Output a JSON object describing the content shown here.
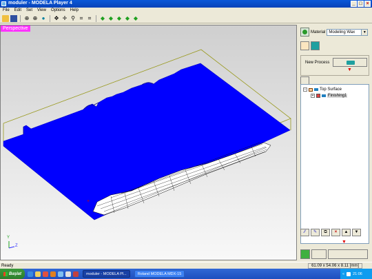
{
  "window": {
    "title": "moduler - MODELA Player 4",
    "controls": [
      "_",
      "□",
      "×"
    ]
  },
  "menu": [
    "File",
    "Edit",
    "Set",
    "View",
    "Options",
    "Help"
  ],
  "viewport": {
    "label": "Perspective",
    "axis_y": "Y",
    "axis_z": "Z"
  },
  "panel": {
    "material_label": "Material",
    "material_value": "Modeling Wax",
    "new_process_label": "New Process",
    "tree": {
      "root": "Top Surface",
      "child": "Finishing1",
      "root_expander": "−",
      "child_expander": "+"
    },
    "buttons": {
      "delete": "×",
      "up": "▲",
      "down": "▼"
    }
  },
  "status": {
    "text": "Ready",
    "dimensions": "61.09 x 54.06 x 8.11 [mm]"
  },
  "taskbar": {
    "start": "Başlat",
    "tasks": [
      "moduler - MODELA Pl...",
      "Roland MODELA MDX-15"
    ],
    "tray_chevron": "«",
    "clock": "21:06"
  },
  "colors": {
    "accent": "#0a58d8",
    "model": "#0000ff",
    "perspective_badge": "#ff33ff",
    "bounding_box": "#9a9a20"
  }
}
